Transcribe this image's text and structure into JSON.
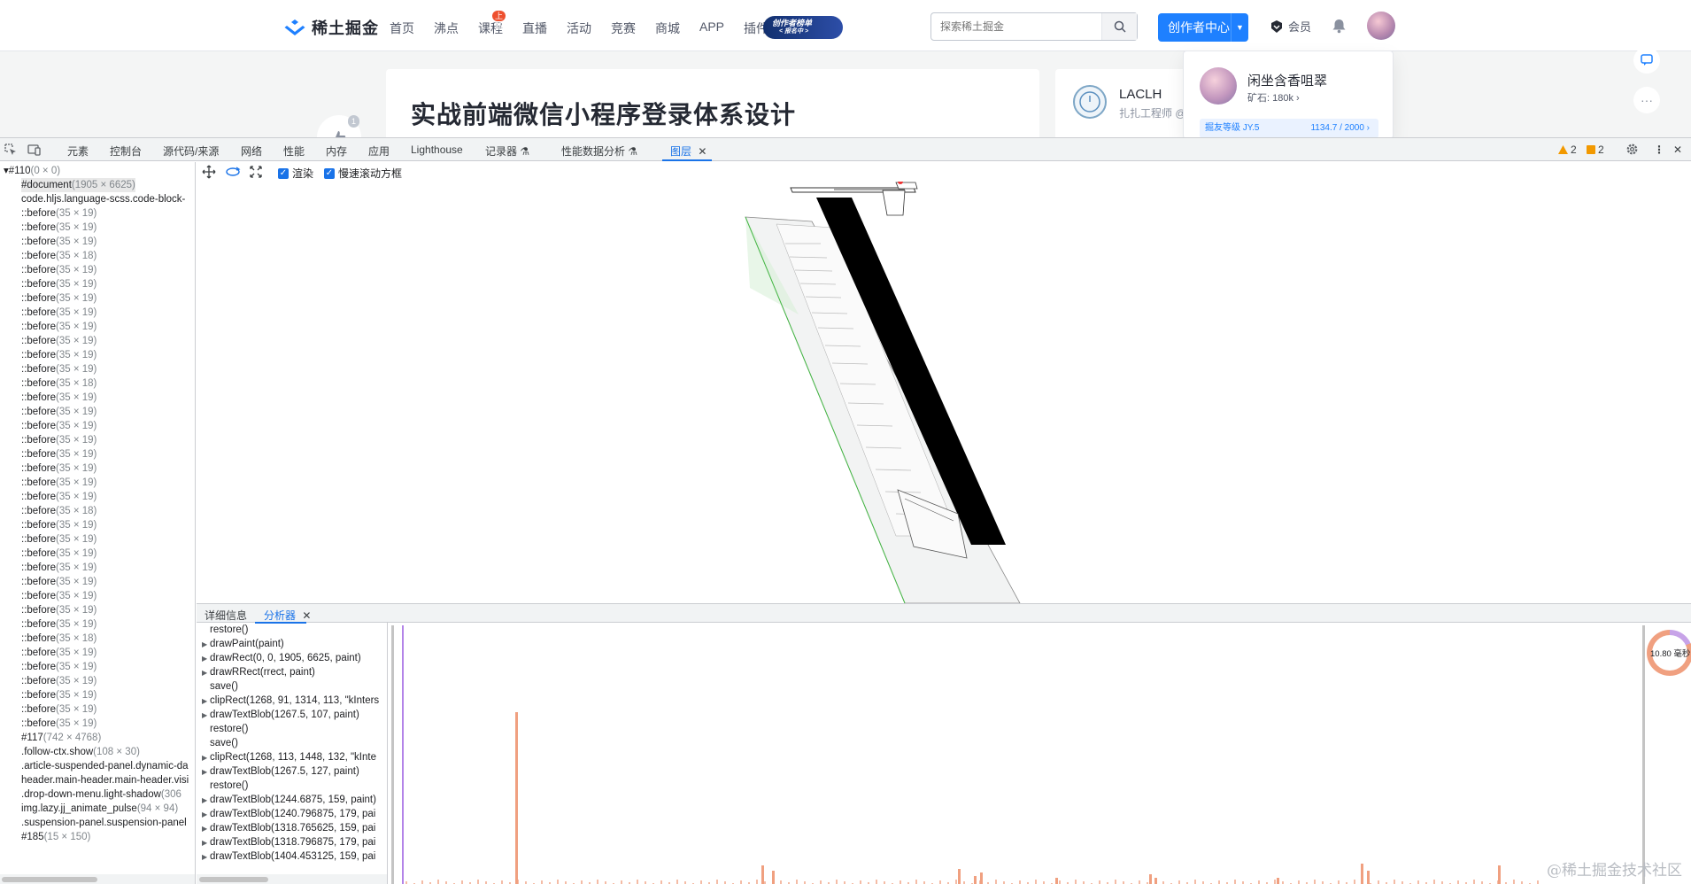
{
  "site": {
    "logo_text": "稀土掘金",
    "nav": [
      {
        "label": "首页"
      },
      {
        "label": "沸点"
      },
      {
        "label": "课程",
        "badge": "上新"
      },
      {
        "label": "直播"
      },
      {
        "label": "活动"
      },
      {
        "label": "竞赛"
      },
      {
        "label": "商城"
      },
      {
        "label": "APP"
      },
      {
        "label": "插件"
      }
    ],
    "promo_line1": "创作者榜单",
    "promo_line2": "< 报名中 >",
    "search_placeholder": "探索稀土掘金",
    "creator_button": "创作者中心",
    "vip_label": "会员",
    "article_title": "实战前端微信小程序登录体系设计",
    "like_count": "1",
    "author_name": "LACLH",
    "author_role": "扎扎工程师 @",
    "user_popup": {
      "name": "闲坐含香咀翠",
      "ore": "矿石: 180k",
      "level_label": "掘友等级 JY.5",
      "level_value": "1134.7 / 2000"
    },
    "brand_color": "#1e80ff"
  },
  "devtools": {
    "tabs": [
      "元素",
      "控制台",
      "源代码/来源",
      "网络",
      "性能",
      "内存",
      "应用",
      "Lighthouse",
      "记录器",
      "性能数据分析",
      "图层"
    ],
    "active_tab": "图层",
    "warnings": "2",
    "issues": "2",
    "layer_toolbar": {
      "paint_label": "渲染",
      "scroll_label": "慢速滚动方框"
    },
    "tree": [
      {
        "name": "▾#110",
        "dim": "(0 × 0)"
      },
      {
        "name": "#document",
        "dim": "(1905 × 6625)"
      },
      {
        "name": "code.hljs.language-scss.code-block-",
        "dim": ""
      },
      {
        "name": "::before",
        "dim": "(35 × 19)"
      },
      {
        "name": "::before",
        "dim": "(35 × 19)"
      },
      {
        "name": "::before",
        "dim": "(35 × 19)"
      },
      {
        "name": "::before",
        "dim": "(35 × 18)"
      },
      {
        "name": "::before",
        "dim": "(35 × 19)"
      },
      {
        "name": "::before",
        "dim": "(35 × 19)"
      },
      {
        "name": "::before",
        "dim": "(35 × 19)"
      },
      {
        "name": "::before",
        "dim": "(35 × 19)"
      },
      {
        "name": "::before",
        "dim": "(35 × 19)"
      },
      {
        "name": "::before",
        "dim": "(35 × 19)"
      },
      {
        "name": "::before",
        "dim": "(35 × 19)"
      },
      {
        "name": "::before",
        "dim": "(35 × 19)"
      },
      {
        "name": "::before",
        "dim": "(35 × 18)"
      },
      {
        "name": "::before",
        "dim": "(35 × 19)"
      },
      {
        "name": "::before",
        "dim": "(35 × 19)"
      },
      {
        "name": "::before",
        "dim": "(35 × 19)"
      },
      {
        "name": "::before",
        "dim": "(35 × 19)"
      },
      {
        "name": "::before",
        "dim": "(35 × 19)"
      },
      {
        "name": "::before",
        "dim": "(35 × 19)"
      },
      {
        "name": "::before",
        "dim": "(35 × 19)"
      },
      {
        "name": "::before",
        "dim": "(35 × 19)"
      },
      {
        "name": "::before",
        "dim": "(35 × 18)"
      },
      {
        "name": "::before",
        "dim": "(35 × 19)"
      },
      {
        "name": "::before",
        "dim": "(35 × 19)"
      },
      {
        "name": "::before",
        "dim": "(35 × 19)"
      },
      {
        "name": "::before",
        "dim": "(35 × 19)"
      },
      {
        "name": "::before",
        "dim": "(35 × 19)"
      },
      {
        "name": "::before",
        "dim": "(35 × 19)"
      },
      {
        "name": "::before",
        "dim": "(35 × 19)"
      },
      {
        "name": "::before",
        "dim": "(35 × 19)"
      },
      {
        "name": "::before",
        "dim": "(35 × 18)"
      },
      {
        "name": "::before",
        "dim": "(35 × 19)"
      },
      {
        "name": "::before",
        "dim": "(35 × 19)"
      },
      {
        "name": "::before",
        "dim": "(35 × 19)"
      },
      {
        "name": "::before",
        "dim": "(35 × 19)"
      },
      {
        "name": "::before",
        "dim": "(35 × 19)"
      },
      {
        "name": "::before",
        "dim": "(35 × 19)"
      },
      {
        "name": "#117",
        "dim": "(742 × 4768)"
      },
      {
        "name": ".follow-ctx.show",
        "dim": "(108 × 30)"
      },
      {
        "name": ".article-suspended-panel.dynamic-da",
        "dim": ""
      },
      {
        "name": "header.main-header.main-header.visi",
        "dim": ""
      },
      {
        "name": ".drop-down-menu.light-shadow",
        "dim": "(306"
      },
      {
        "name": "img.lazy.jj_animate_pulse",
        "dim": "(94 × 94)"
      },
      {
        "name": ".suspension-panel.suspension-panel",
        "dim": ""
      },
      {
        "name": "#185",
        "dim": "(15 × 150)"
      }
    ],
    "bottom_tabs": [
      "详细信息",
      "分析器"
    ],
    "active_bottom_tab": "分析器",
    "commands": [
      {
        "tri": false,
        "text": "restore()"
      },
      {
        "tri": true,
        "text": "drawPaint(paint)"
      },
      {
        "tri": true,
        "text": "drawRect(0, 0, 1905, 6625, paint)"
      },
      {
        "tri": true,
        "text": "drawRRect(rrect, paint)"
      },
      {
        "tri": false,
        "text": "save()"
      },
      {
        "tri": true,
        "text": "clipRect(1268, 91, 1314, 113, \"kInters"
      },
      {
        "tri": true,
        "text": "drawTextBlob(1267.5, 107, paint)"
      },
      {
        "tri": false,
        "text": "restore()"
      },
      {
        "tri": false,
        "text": "save()"
      },
      {
        "tri": true,
        "text": "clipRect(1268, 113, 1448, 132, \"kInte"
      },
      {
        "tri": true,
        "text": "drawTextBlob(1267.5, 127, paint)"
      },
      {
        "tri": false,
        "text": "restore()"
      },
      {
        "tri": true,
        "text": "drawTextBlob(1244.6875, 159, paint)"
      },
      {
        "tri": true,
        "text": "drawTextBlob(1240.796875, 179, pai"
      },
      {
        "tri": true,
        "text": "drawTextBlob(1318.765625, 159, pai"
      },
      {
        "tri": true,
        "text": "drawTextBlob(1318.796875, 179, pai"
      },
      {
        "tri": true,
        "text": "drawTextBlob(1404.453125, 159, pai"
      }
    ],
    "profiler_timer": "10.80 毫秒",
    "watermark": "@稀土掘金技术社区"
  }
}
